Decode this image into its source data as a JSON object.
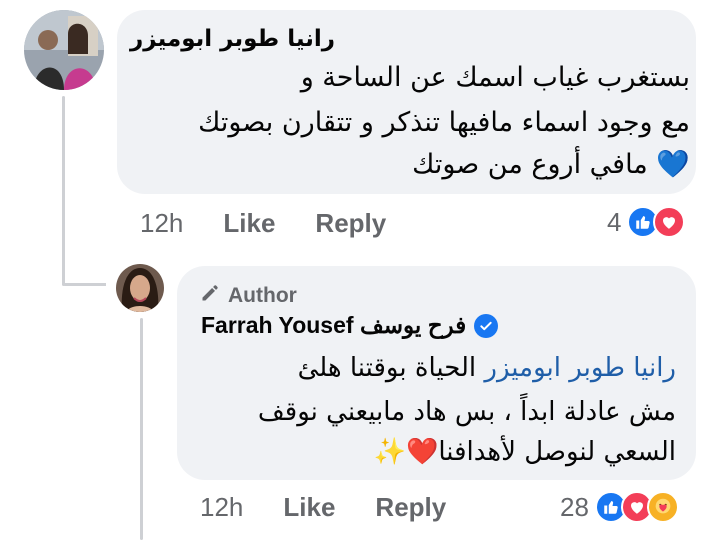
{
  "comment": {
    "author": "رانيا طوبر ابوميزر",
    "lines": [
      "بستغرب غياب اسمك عن الساحة و",
      "مع وجود اسماء مافيها تنذكر و تتقارن بصوتك",
      "مافي أروع من صوتك"
    ],
    "emoji": "💙",
    "time": "12h",
    "like_label": "Like",
    "reply_label": "Reply",
    "reaction_count": "4"
  },
  "reply": {
    "author_badge": "Author",
    "author_name": "Farrah Yousef فرح يوسف",
    "mention": "رانيا طوبر ابوميزر",
    "line1_rest": " الحياة بوقتنا هلئ",
    "line2": "مش عادلة ابداً ، بس هاد مابيعني نوقف",
    "line3": "السعي لنوصل لأهدافنا",
    "emojis": "❤️✨",
    "time": "12h",
    "like_label": "Like",
    "reply_label": "Reply",
    "reaction_count": "28"
  },
  "colors": {
    "bubble": "#f0f2f5",
    "meta_text": "#65676b",
    "like_blue": "#1877f2",
    "love_red": "#f33e58",
    "care_yellow": "#f7b125",
    "mention": "#1f5ea8"
  },
  "icons": {
    "comment_avatar": "avatar-photo",
    "reply_avatar": "avatar-photo",
    "author_badge_icon": "pencil-icon",
    "verified_icon": "verified-badge-icon",
    "reactions_comment": [
      "like-reaction-icon",
      "love-reaction-icon"
    ],
    "reactions_reply": [
      "like-reaction-icon",
      "love-reaction-icon",
      "care-reaction-icon"
    ]
  }
}
